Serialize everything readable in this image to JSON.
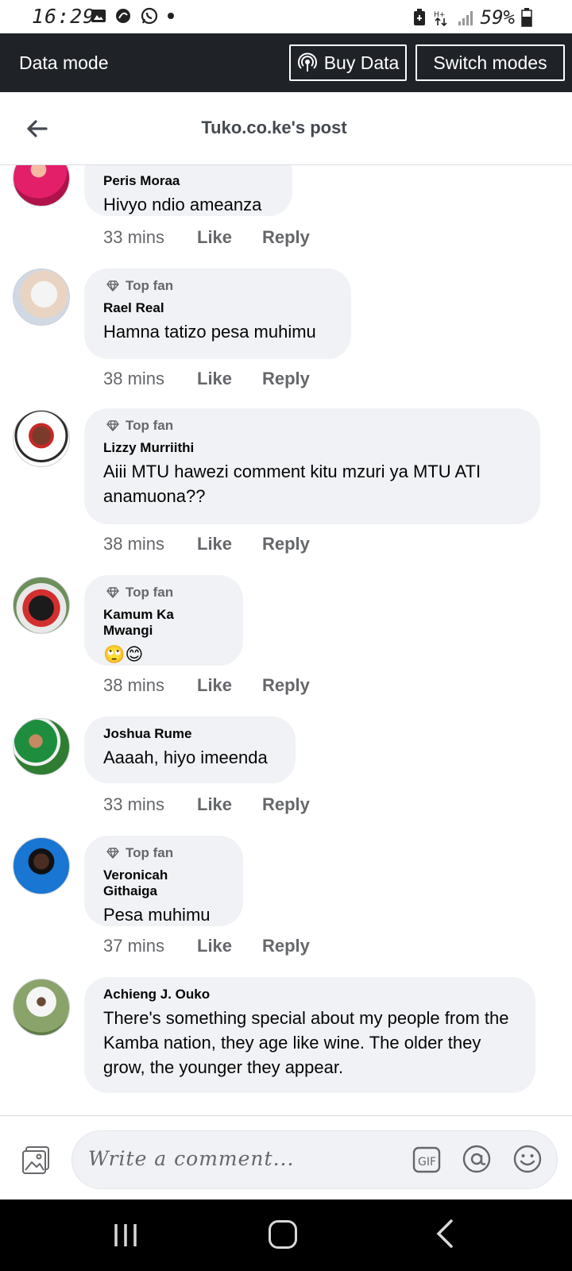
{
  "status_bar": {
    "time": "16:29",
    "battery": "59%"
  },
  "data_bar": {
    "label": "Data mode",
    "buy_label": "Buy Data",
    "switch_label": "Switch modes"
  },
  "header": {
    "title": "Tuko.co.ke's post"
  },
  "comments": [
    {
      "author": "Peris Moraa",
      "top_fan": "",
      "text": "Hivyo ndio ameanza",
      "time": "33 mins",
      "like": "Like",
      "reply": "Reply"
    },
    {
      "author": "Rael Real",
      "top_fan": "Top fan",
      "text": "Hamna tatizo pesa muhimu",
      "time": "38 mins",
      "like": "Like",
      "reply": "Reply"
    },
    {
      "author": "Lizzy Murriithi",
      "top_fan": "Top fan",
      "text": "Aiii MTU hawezi comment kitu mzuri ya MTU ATI anamuona??",
      "time": "38 mins",
      "like": "Like",
      "reply": "Reply"
    },
    {
      "author": "Kamum Ka Mwangi",
      "top_fan": "Top fan",
      "text": "🙄😊",
      "time": "38 mins",
      "like": "Like",
      "reply": "Reply"
    },
    {
      "author": "Joshua Rume",
      "top_fan": "",
      "text": "Aaaah, hiyo imeenda",
      "time": "33 mins",
      "like": "Like",
      "reply": "Reply"
    },
    {
      "author": "Veronicah Githaiga",
      "top_fan": "Top fan",
      "text": "Pesa muhimu",
      "time": "37 mins",
      "like": "Like",
      "reply": "Reply"
    },
    {
      "author": "Achieng J. Ouko",
      "top_fan": "",
      "text": "There's something special about my people from the Kamba nation, they age like wine. The older they grow, the younger they appear."
    }
  ],
  "composer": {
    "placeholder": "Write a comment..."
  },
  "colors": {
    "bubble": "#f0f2f5",
    "data_bar": "#1f2227",
    "secondary_text": "#65676b"
  }
}
